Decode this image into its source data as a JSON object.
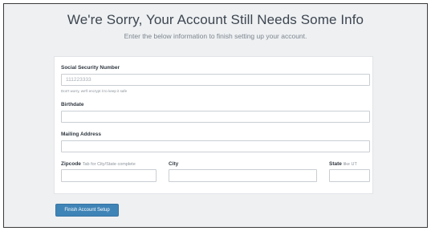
{
  "header": {
    "title": "We're Sorry, Your Account Still Needs Some Info",
    "subtitle": "Enter the below information to finish setting up your account."
  },
  "form": {
    "ssn": {
      "label": "Social Security Number",
      "placeholder": "111223333",
      "help": "Don't worry, we'll encrypt it to keep it safe"
    },
    "birthdate": {
      "label": "Birthdate",
      "value": ""
    },
    "mailing_address": {
      "label": "Mailing Address",
      "value": ""
    },
    "zipcode": {
      "label": "Zipcode",
      "hint": "Tab for City/State complete",
      "value": ""
    },
    "city": {
      "label": "City",
      "value": ""
    },
    "state": {
      "label": "State",
      "hint": "like UT",
      "value": ""
    }
  },
  "actions": {
    "submit_label": "Finish Account Setup"
  }
}
